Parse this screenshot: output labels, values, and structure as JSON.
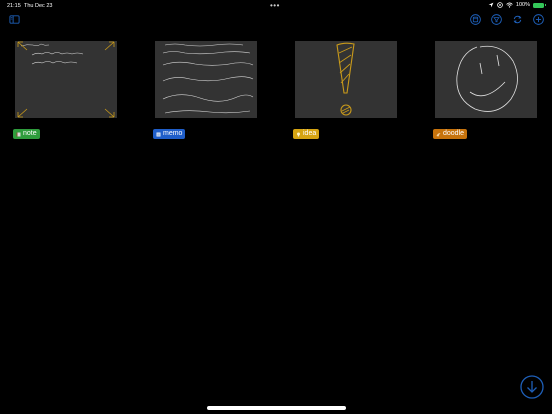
{
  "status": {
    "time": "21:15",
    "date": "Thu Dec 23",
    "multitask_dots": "•••",
    "battery_percent": "100%",
    "battery_level": 1.0
  },
  "toolbar": {
    "sidebar_icon": "sidebar-icon",
    "right_icons": [
      "stack-icon",
      "filter-icon",
      "sync-icon",
      "add-icon"
    ]
  },
  "cards": [
    {
      "label": "note",
      "tag_color": "#2e9c3c",
      "tag_icon": "book-icon"
    },
    {
      "label": "memo",
      "tag_color": "#1f5ec9",
      "tag_icon": "memo-icon"
    },
    {
      "label": "idea",
      "tag_color": "#d6a412",
      "tag_icon": "lightbulb-icon"
    },
    {
      "label": "doodle",
      "tag_color": "#c7730c",
      "tag_icon": "paint-icon"
    }
  ],
  "colors": {
    "accent": "#1e5fb8",
    "background": "#000000",
    "thumb_bg": "#333333",
    "ink_note": "#e1e1e1",
    "ink_gold": "#c99a1a"
  },
  "fab_icon": "download-arrow-icon"
}
